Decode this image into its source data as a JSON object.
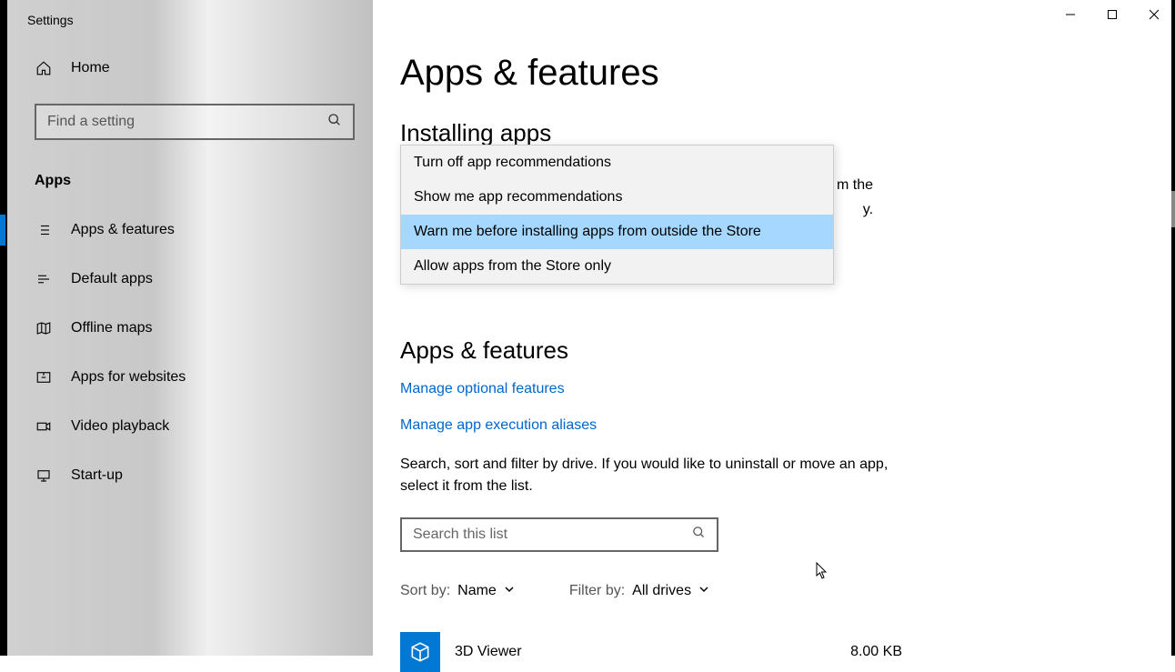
{
  "window": {
    "title": "Settings"
  },
  "sidebar": {
    "home": "Home",
    "search_placeholder": "Find a setting",
    "category": "Apps",
    "items": [
      {
        "label": "Apps & features"
      },
      {
        "label": "Default apps"
      },
      {
        "label": "Offline maps"
      },
      {
        "label": "Apps for websites"
      },
      {
        "label": "Video playback"
      },
      {
        "label": "Start-up"
      }
    ]
  },
  "main": {
    "page_title": "Apps & features",
    "installing_header": "Installing apps",
    "behind_line1": "m the",
    "behind_line2": "y.",
    "apps_features_header": "Apps & features",
    "link_optional": "Manage optional features",
    "link_aliases": "Manage app execution aliases",
    "search_desc": "Search, sort and filter by drive. If you would like to uninstall or move an app, select it from the list.",
    "app_search_placeholder": "Search this list",
    "sort_label": "Sort by:",
    "sort_value": "Name",
    "filter_label": "Filter by:",
    "filter_value": "All drives",
    "app1": {
      "name": "3D Viewer",
      "size": "8.00 KB"
    }
  },
  "dropdown": {
    "items": [
      "Turn off app recommendations",
      "Show me app recommendations",
      "Warn me before installing apps from outside the Store",
      "Allow apps from the Store only"
    ],
    "highlighted_index": 2
  }
}
